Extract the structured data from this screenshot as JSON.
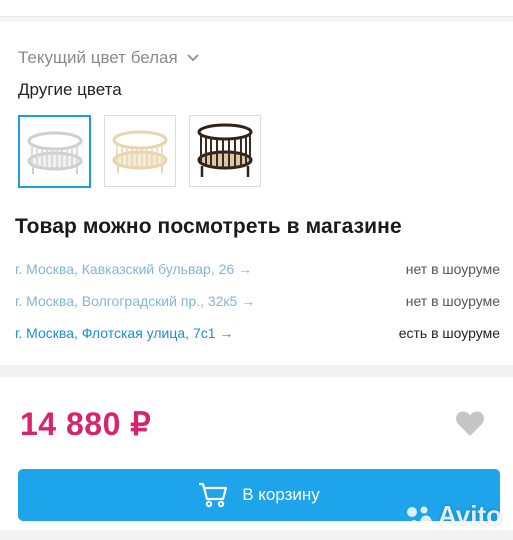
{
  "current_color": {
    "text": "Текущий цвет белая",
    "icon": "chevron-down-icon"
  },
  "other_colors": {
    "label": "Другие цвета",
    "swatches": [
      {
        "color": "white",
        "frame_color": "#d9d9d9",
        "selected": true
      },
      {
        "color": "ivory",
        "frame_color": "#e8d9b5",
        "selected": false
      },
      {
        "color": "wenge",
        "frame_color": "#3a2a20",
        "selected": false
      }
    ]
  },
  "stores": {
    "heading": "Товар можно посмотреть в магазине",
    "items": [
      {
        "address": "г. Москва, Кавказский бульвар, 26 →",
        "status": "нет в шоуруме"
      },
      {
        "address": "г. Москва, Волгоградский пр., 32к5 →",
        "status": "нет в шоуруме"
      },
      {
        "address": "г. Москва, Флотская улица, 7с1 →",
        "status": "есть в шоуруме"
      }
    ]
  },
  "price": {
    "value": "14 880 ₽",
    "color": "#d6256e"
  },
  "cart_button": {
    "label": "В корзину",
    "color": "#1ea4ea",
    "icon": "cart-icon"
  },
  "favorite": {
    "icon": "heart-icon"
  },
  "watermark": {
    "text": "Avito"
  }
}
